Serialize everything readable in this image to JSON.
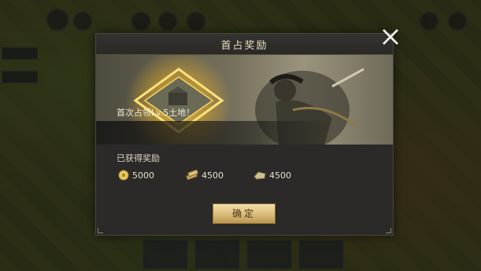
{
  "dialog": {
    "title": "首占奖励",
    "banner_text": "首次占领Lv.5土地！",
    "rewards_heading": "已获得奖励",
    "rewards": [
      {
        "icon": "coin-icon",
        "amount": "5000"
      },
      {
        "icon": "wood-icon",
        "amount": "4500"
      },
      {
        "icon": "stone-icon",
        "amount": "4500"
      }
    ],
    "confirm_label": "确定"
  },
  "colors": {
    "accent_gold": "#d5b774",
    "title_text": "#e9dfc4",
    "panel_bg": "#2b2a29"
  }
}
